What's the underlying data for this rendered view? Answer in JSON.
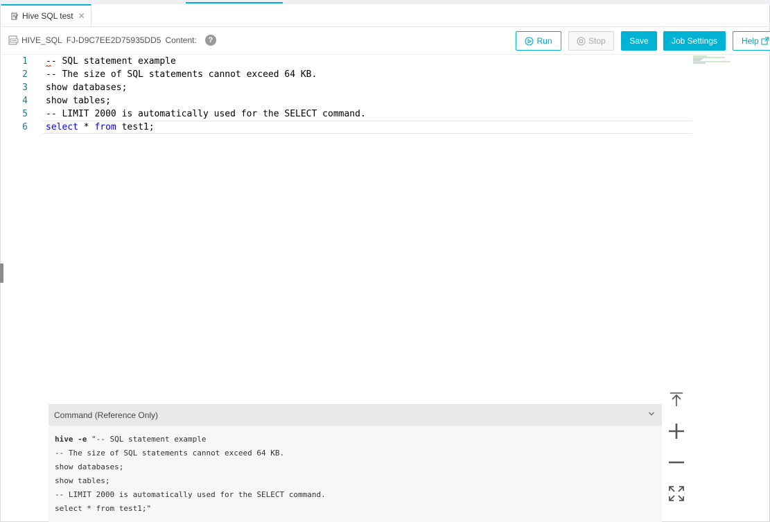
{
  "tab": {
    "title": "Hive SQL test",
    "close_glyph": "✕",
    "icon": "edit-file-icon"
  },
  "job": {
    "type": "HIVE_SQL",
    "id": "FJ-D9C7EE2D75935DD5",
    "content_label": "Content:",
    "help_glyph": "?"
  },
  "toolbar": {
    "run_label": "Run",
    "stop_label": "Stop",
    "save_label": "Save",
    "job_settings_label": "Job Settings",
    "help_label": "Help"
  },
  "editor": {
    "lines": [
      {
        "num": "1",
        "text": "-- SQL statement example"
      },
      {
        "num": "2",
        "text": "-- The size of SQL statements cannot exceed 64 KB."
      },
      {
        "num": "3",
        "text": "show databases;"
      },
      {
        "num": "4",
        "text": "show tables;"
      },
      {
        "num": "5",
        "text": "-- LIMIT 2000 is automatically used for the SELECT command."
      },
      {
        "num": "6",
        "select": "select",
        "star": "*",
        "from": "from",
        "rest": "test1;"
      }
    ]
  },
  "command": {
    "title": "Command (Reference Only)",
    "prefix": "hive -e",
    "lines": [
      "\"-- SQL statement example",
      "-- The size of SQL statements cannot exceed 64 KB.",
      "show databases;",
      "show tables;",
      "-- LIMIT 2000 is automatically used for the SELECT command.",
      "select * from test1;\""
    ]
  },
  "colors": {
    "accent": "#00b3d4",
    "comment": "#008000",
    "keyword": "#0000ff",
    "line_number": "#237893"
  }
}
